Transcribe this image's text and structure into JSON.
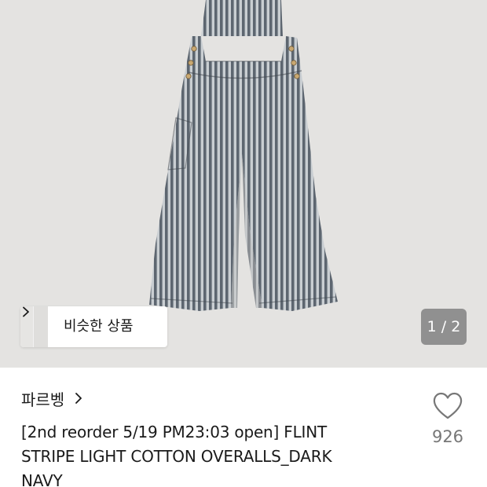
{
  "product_image": {
    "subject": "striped overalls photo",
    "background_color": "#e4e3e1",
    "stripe_colors": [
      "#5d6670",
      "#c9ced2"
    ]
  },
  "similar_products": {
    "label": "비슷한 상품",
    "icon": "chevron-right-icon"
  },
  "gallery": {
    "counter": "1 / 2"
  },
  "product": {
    "brand": "파르벵",
    "brand_icon": "chevron-right-icon",
    "title_lines": [
      "[2nd reorder 5/19 PM23:03 open] FLINT",
      "STRIPE LIGHT COTTON OVERALLS_DARK",
      "NAVY"
    ]
  },
  "like": {
    "icon": "heart-outline-icon",
    "count": "926",
    "color": "#777777"
  }
}
